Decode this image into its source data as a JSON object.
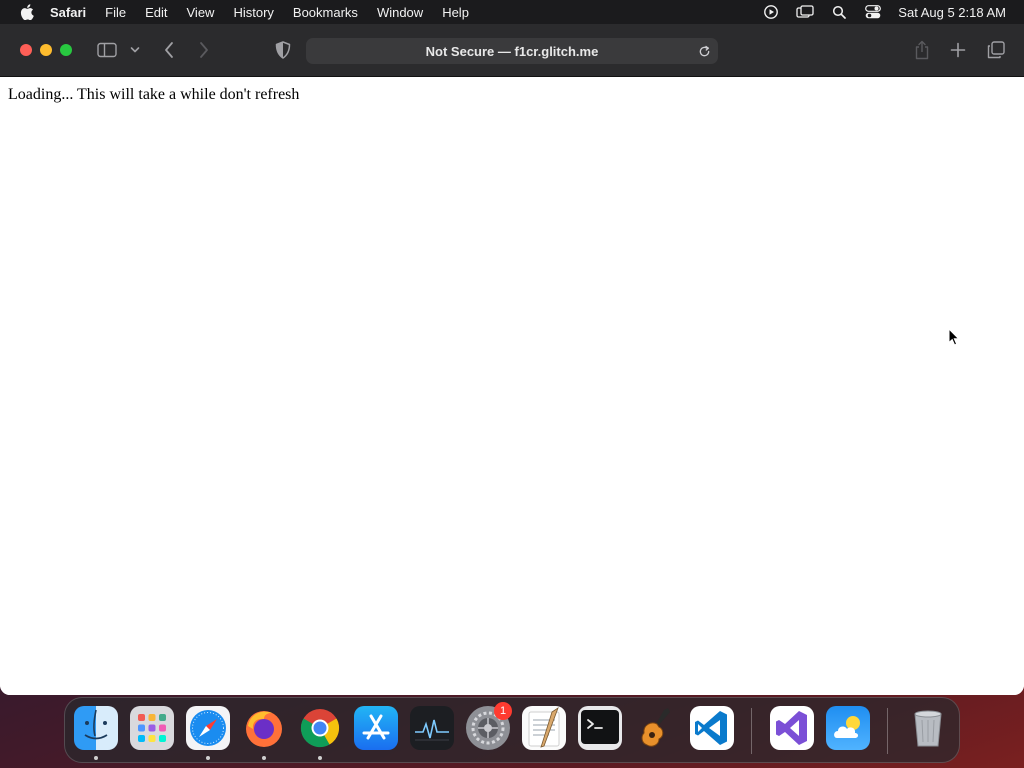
{
  "menubar": {
    "app_name": "Safari",
    "items": [
      "File",
      "Edit",
      "View",
      "History",
      "Bookmarks",
      "Window",
      "Help"
    ],
    "clock": "Sat Aug 5  2:18 AM",
    "status_icons": [
      "screen-recording-icon",
      "screen-mirroring-icon",
      "spotlight-search-icon",
      "control-center-icon"
    ]
  },
  "browser": {
    "address": "Not Secure — f1cr.glitch.me",
    "page_text": "Loading... This will take a while don't refresh"
  },
  "dock": {
    "apps": [
      "Finder",
      "Launchpad",
      "Safari",
      "Firefox",
      "Google Chrome",
      "App Store",
      "Activity Monitor",
      "System Settings",
      "TextEdit",
      "Terminal",
      "GarageBand",
      "Visual Studio Code",
      "Visual Studio",
      "Weather",
      "Trash"
    ],
    "settings_badge": "1"
  },
  "colors": {
    "close": "#fe5f57",
    "minimize": "#febc2e",
    "maximize": "#28c840",
    "badge": "#ff3b30"
  }
}
